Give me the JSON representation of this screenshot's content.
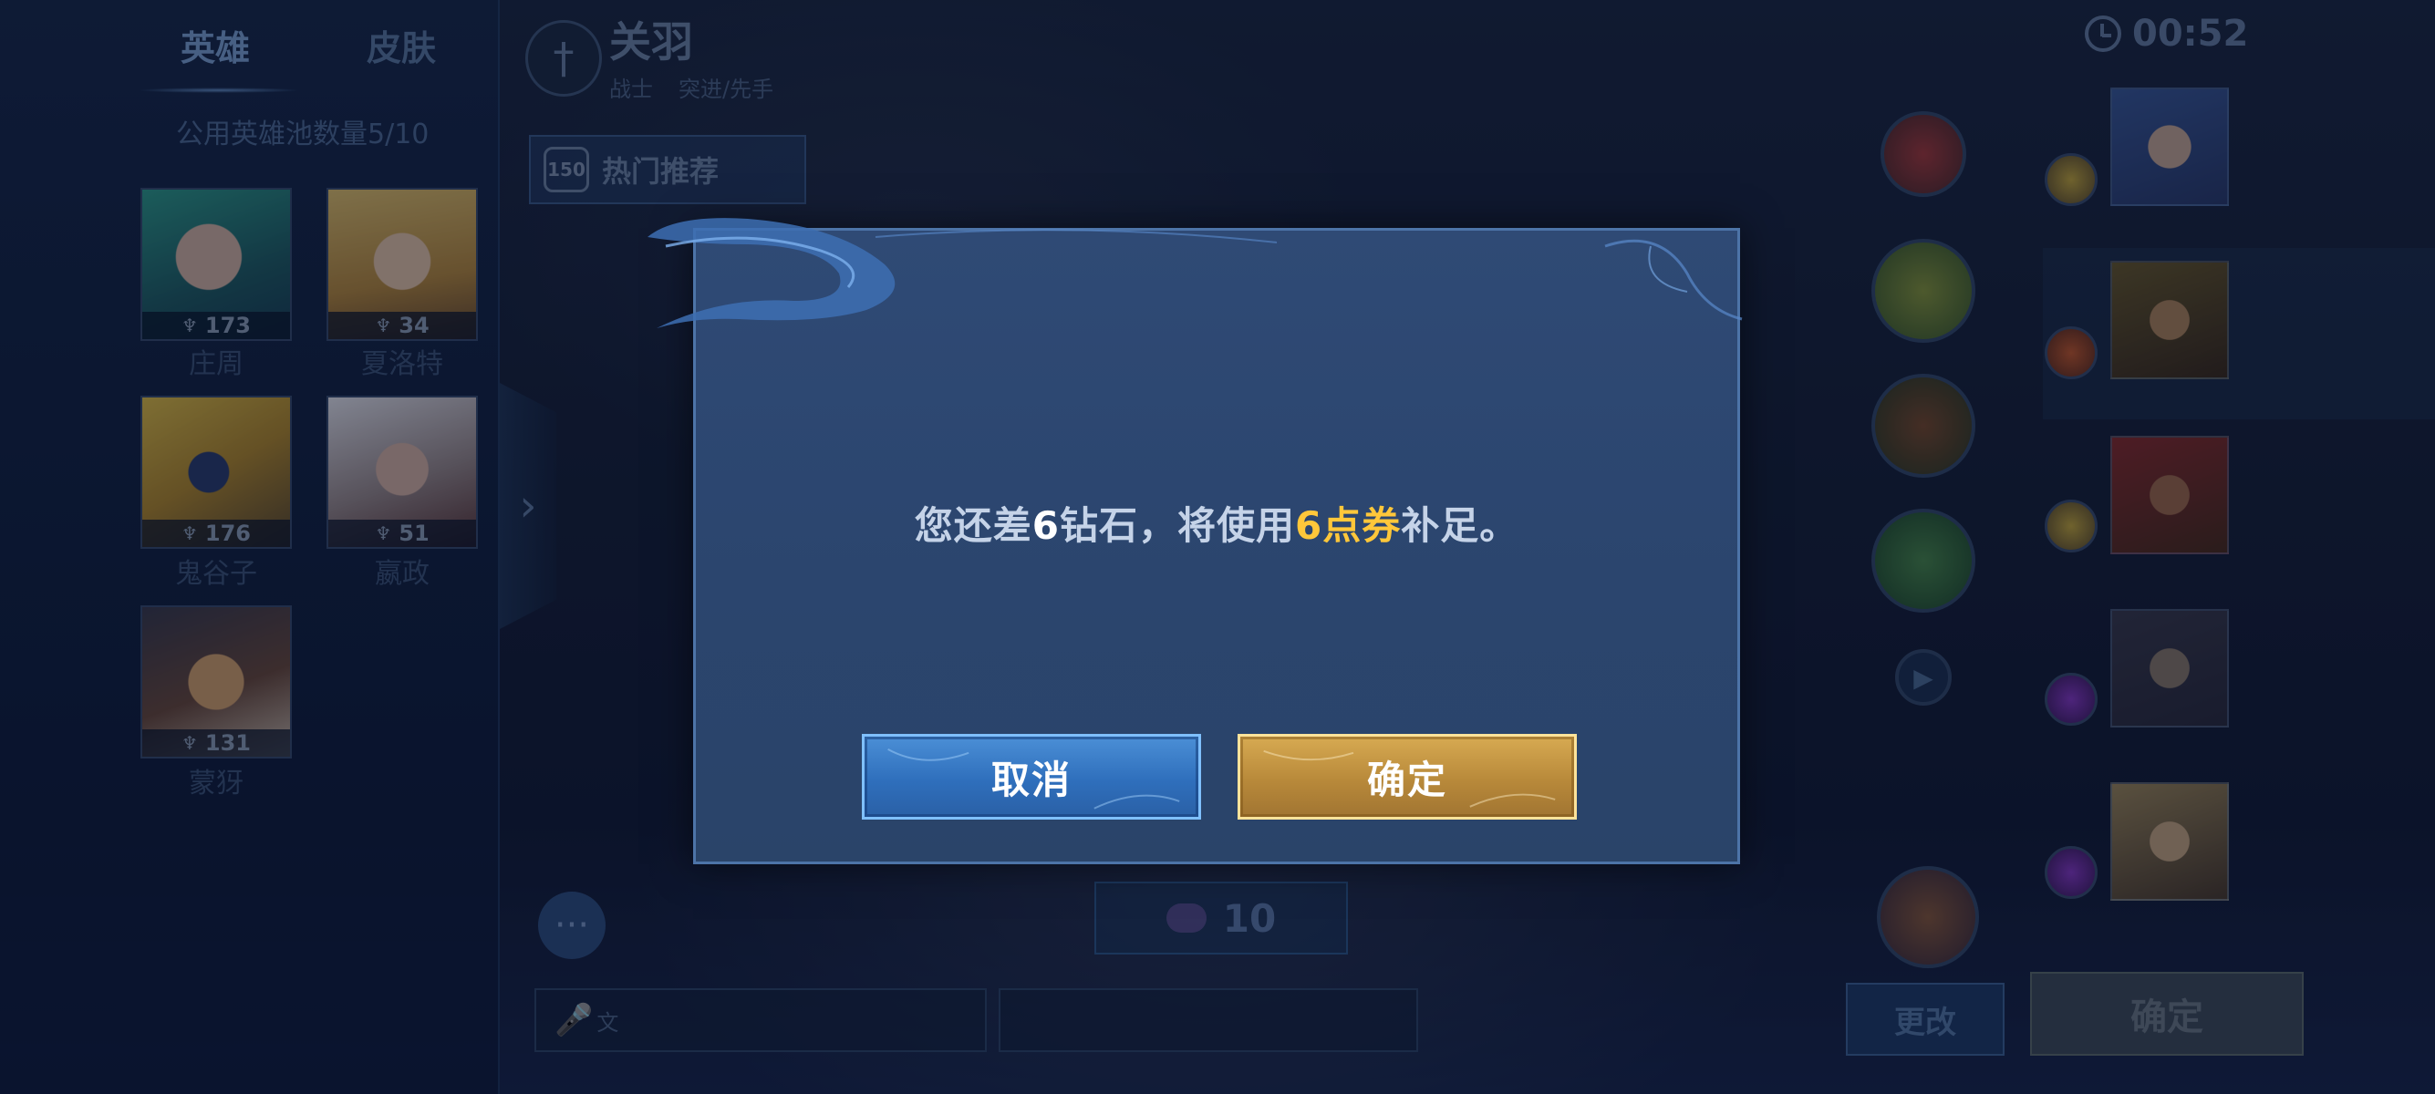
{
  "left_panel": {
    "tabs": {
      "heroes": "英雄",
      "skins": "皮肤"
    },
    "pool_count": "公用英雄池数量5/10",
    "heroes": [
      {
        "name": "庄周",
        "score": "173"
      },
      {
        "name": "夏洛特",
        "score": "34"
      },
      {
        "name": "鬼谷子",
        "score": "176"
      },
      {
        "name": "嬴政",
        "score": "51"
      },
      {
        "name": "蒙犽",
        "score": "131"
      }
    ]
  },
  "header": {
    "hero_name": "关羽",
    "role": "战士",
    "position": "突进/先手",
    "hot_badge": "150",
    "hot_label": "热门推荐"
  },
  "timer": "00:52",
  "bottom": {
    "diamond_cost": "10",
    "change_label": "更改",
    "confirm_label": "确定",
    "voice_icon_text": "文"
  },
  "modal": {
    "message_parts": [
      "您还差",
      "6",
      "钻石，将使用",
      "6点券",
      "补足。"
    ],
    "cancel_label": "取消",
    "confirm_label": "确定"
  },
  "colors": {
    "modal_bg": "#2c466f",
    "highlight_gold": "#ffc73a",
    "cancel_blue": "#3a7fcb",
    "confirm_gold": "#c79a46"
  },
  "icons": [
    "sword-icon",
    "clock-icon",
    "chevron-right-icon",
    "more-icon",
    "voice-icon",
    "diamond-icon",
    "trophy-icon"
  ]
}
